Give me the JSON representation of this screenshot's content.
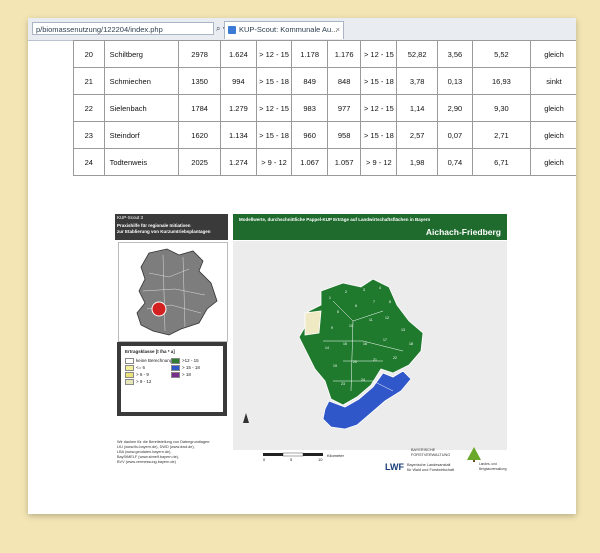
{
  "browser": {
    "address": "p/biomassenutzung/122204/index.php",
    "address_controls": "⌕ ▾ ↻",
    "tab_title": "KUP-Scout: Kommunale Au...",
    "tab_close": "×"
  },
  "table": {
    "rows": [
      {
        "nr": "20",
        "name": "Schiltberg",
        "c1": "2978",
        "c2": "1.624",
        "c3": "> 12 - 15",
        "c4": "1.178",
        "c5": "1.176",
        "c6": "> 12 - 15",
        "c7": "52,82",
        "c8": "3,56",
        "c9": "5,52",
        "c10": "gleich"
      },
      {
        "nr": "21",
        "name": "Schmiechen",
        "c1": "1350",
        "c2": "994",
        "c3": "> 15 - 18",
        "c4": "849",
        "c5": "848",
        "c6": "> 15 - 18",
        "c7": "3,78",
        "c8": "0,13",
        "c9": "16,93",
        "c10": "sinkt"
      },
      {
        "nr": "22",
        "name": "Sielenbach",
        "c1": "1784",
        "c2": "1.279",
        "c3": "> 12 - 15",
        "c4": "983",
        "c5": "977",
        "c6": "> 12 - 15",
        "c7": "1,14",
        "c8": "2,90",
        "c9": "9,30",
        "c10": "gleich"
      },
      {
        "nr": "23",
        "name": "Steindorf",
        "c1": "1620",
        "c2": "1.134",
        "c3": "> 15 - 18",
        "c4": "960",
        "c5": "958",
        "c6": "> 15 - 18",
        "c7": "2,57",
        "c8": "0,07",
        "c9": "2,71",
        "c10": "gleich"
      },
      {
        "nr": "24",
        "name": "Todtenweis",
        "c1": "2025",
        "c2": "1.274",
        "c3": "> 9 - 12",
        "c4": "1.067",
        "c5": "1.057",
        "c6": "> 9 - 12",
        "c7": "1,98",
        "c8": "0,74",
        "c9": "6,71",
        "c10": "gleich"
      }
    ]
  },
  "poster": {
    "left_header": [
      "KUP-Scout 3",
      "Praxishilfe für regionale Initiativen",
      "zur Etablierung von Kurzumtriebsplantagen"
    ],
    "right_header": "Modellwerte, durchschnittliche Pappel-KUP Erträge auf Landwirtschaftsflächen in Bayern",
    "district": "Aichach-Friedberg",
    "legend": {
      "title": "Ertragsklasse [t /ha * a]",
      "items": [
        {
          "label": "keine Berechnung",
          "color": "#ffffff"
        },
        {
          "label": "<= 6",
          "color": "#f4ef9a"
        },
        {
          "label": "> 6 - 9",
          "color": "#ece27a"
        },
        {
          "label": "> 9 - 12",
          "color": "#e6e7b8"
        },
        {
          "label": ">12 - 15",
          "color": "#2e7d32"
        },
        {
          "label": "> 15 - 18",
          "color": "#2f57c9"
        },
        {
          "label": "> 18",
          "color": "#7b2d8e"
        }
      ]
    },
    "credits": [
      "Wir danken für die Bereitstellung von Datengrundlagen:",
      "LfU (www.lfu.bayern.de), DWD (www.dwd.de),",
      "LBA (www.geodaten.bayern.de),",
      "BayStMELF (www.stmelf.bayern.de),",
      "BVV (www.vermessung.bayern.de)"
    ],
    "scale_label": "Kilometer",
    "scale_ticks": [
      "0",
      "5",
      "10"
    ],
    "logos": {
      "lwf": "LWF",
      "lwf_text": [
        "Bayerische Landesanstalt",
        "für Wald und Forstwirtschaft"
      ],
      "partner1": [
        "BAYERISCHE",
        "FORSTVERWALTUNG"
      ],
      "partner2": [
        "Landes- und",
        "Bergbauverwaltung"
      ]
    },
    "map_numbers": [
      "1",
      "2",
      "3",
      "4",
      "5",
      "6",
      "7",
      "8",
      "9",
      "10",
      "11",
      "12",
      "13",
      "14",
      "15",
      "16",
      "17",
      "18",
      "19",
      "20",
      "21",
      "22",
      "23",
      "24"
    ],
    "colors": {
      "green": "#1f7a2e",
      "blue": "#2f57c9",
      "beige": "#efe9c4",
      "map_bg": "#ececec"
    }
  }
}
